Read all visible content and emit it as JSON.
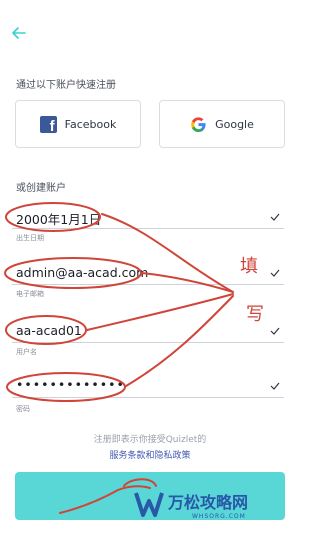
{
  "header": {
    "back_icon": "arrow-left-icon"
  },
  "social": {
    "section_label": "通过以下账户快速注册",
    "facebook_label": "Facebook",
    "google_label": "Google"
  },
  "form": {
    "section_label": "或创建账户",
    "fields": [
      {
        "value": "2000年1月1日",
        "hint": "出生日期"
      },
      {
        "value": "admin@aa-acad.com",
        "hint": "电子邮箱"
      },
      {
        "value": "aa-acad01",
        "hint": "用户名"
      },
      {
        "value": "•••••••••••••",
        "hint": "密码"
      }
    ]
  },
  "terms": {
    "line1": "注册即表示你接受Quizlet的",
    "line2": "服务条款和隐私政策"
  },
  "annotation": {
    "handwriting": [
      "填",
      "写"
    ]
  },
  "watermark": {
    "title": "万松攻略网",
    "url": "WHSORG.COM"
  },
  "colors": {
    "accent": "#3ccfcf",
    "annotation": "#d0453a",
    "link": "#4257b2",
    "facebook": "#3b5998"
  }
}
